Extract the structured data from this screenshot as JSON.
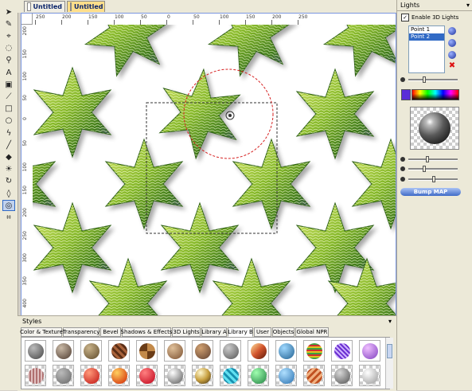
{
  "tabs": [
    {
      "label": "Untitled"
    },
    {
      "label": "Untitled"
    }
  ],
  "rulers": {
    "h_labels": [
      "250",
      "200",
      "150",
      "100",
      "50",
      "0",
      "50",
      "100",
      "150",
      "200",
      "250"
    ],
    "v_labels": [
      "200",
      "150",
      "100",
      "50",
      "0",
      "50",
      "100",
      "150",
      "200",
      "250",
      "300",
      "350",
      "400"
    ]
  },
  "lights_panel": {
    "title": "Lights",
    "enable_label": "Enable 3D Lights",
    "enabled": true,
    "lights": [
      "Point 1",
      "Point 2"
    ],
    "selected_light": "Point 2",
    "bump_button": "Bump MAP",
    "accent_color": "#5a2dd8"
  },
  "styles_panel": {
    "title": "Styles",
    "tabs": [
      "Color & Texture",
      "Transparency",
      "Bevel",
      "Shadows & Effects",
      "3D Lights",
      "Library A",
      "Library B",
      "User",
      "Objects",
      "Global NPR"
    ],
    "active_tab": "Library B"
  },
  "tools": [
    "arrow-icon",
    "pen-icon",
    "node-icon",
    "lasso-icon",
    "zoom-icon",
    "text-icon",
    "image-icon",
    "eyedropper-icon",
    "rectangle-icon",
    "circle-icon",
    "bezier-icon",
    "line-icon",
    "fill-icon",
    "light-icon",
    "rotate-icon",
    "deform-icon",
    "lens-icon",
    "crop-icon"
  ]
}
